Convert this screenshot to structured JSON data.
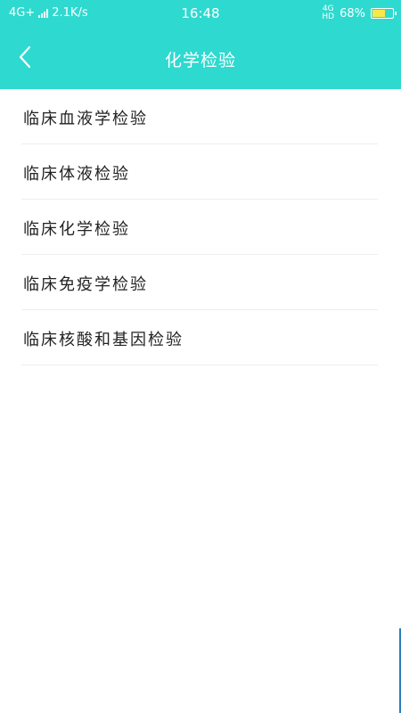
{
  "status_bar": {
    "network_left": "4G+",
    "speed": "2.1K/s",
    "time": "16:48",
    "network_right_top": "4G",
    "network_right_bottom": "HD",
    "battery_percent": "68%",
    "battery_level": 0.68,
    "battery_color": "#f5e94a"
  },
  "header": {
    "title": "化学检验",
    "back_icon": "chevron-left-icon",
    "background_color": "#2ed9cf"
  },
  "items": [
    {
      "label": "临床血液学检验"
    },
    {
      "label": "临床体液检验"
    },
    {
      "label": "临床化学检验"
    },
    {
      "label": "临床免疫学检验"
    },
    {
      "label": "临床核酸和基因检验"
    }
  ]
}
